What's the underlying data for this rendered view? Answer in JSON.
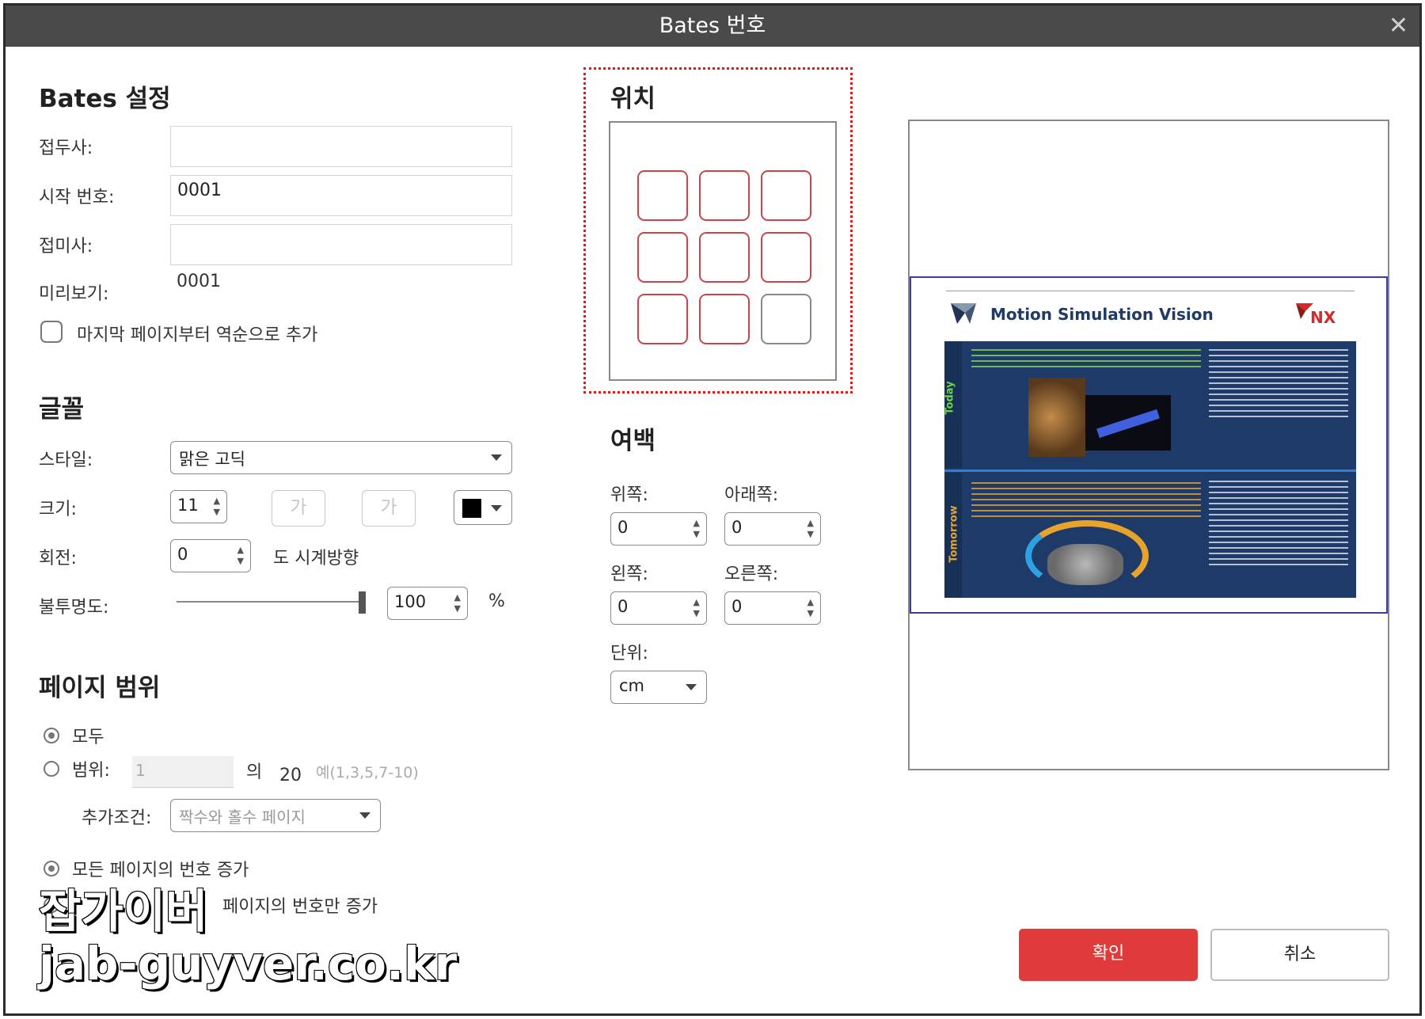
{
  "window": {
    "title": "Bates 번호",
    "close_glyph": "✕"
  },
  "bates": {
    "title": "Bates 설정",
    "prefix_label": "접두사:",
    "prefix_value": "",
    "start_label": "시작 번호:",
    "start_value": "0001",
    "suffix_label": "접미사:",
    "suffix_value": "",
    "preview_label": "미리보기:",
    "preview_value": "0001",
    "reverse_label": "마지막 페이지부터 역순으로 추가"
  },
  "font": {
    "title": "글꼴",
    "style_label": "스타일:",
    "style_value": "맑은 고딕",
    "size_label": "크기:",
    "size_value": "11",
    "bold_glyph": "가",
    "italic_glyph": "가",
    "color": "#000000",
    "rotation_label": "회전:",
    "rotation_value": "0",
    "rotation_unit": "도 시계방향",
    "opacity_label": "불투명도:",
    "opacity_value": "100",
    "opacity_unit": "%"
  },
  "range": {
    "title": "페이지 범위",
    "all_label": "모두",
    "range_label": "범위:",
    "range_value": "1",
    "of_label": "의",
    "total_pages": "20",
    "example": "예(1,3,5,7-10)",
    "condition_label": "추가조건:",
    "condition_value": "짝수와 홀수 페이지",
    "increment_all_label": "모든 페이지의 번호 증가",
    "increment_only_label": "페이지의 번호만 증가"
  },
  "position": {
    "title": "위치",
    "selected_index": 8
  },
  "margin": {
    "title": "여백",
    "top_label": "위쪽:",
    "top_value": "0",
    "bottom_label": "아래쪽:",
    "bottom_value": "0",
    "left_label": "왼쪽:",
    "left_value": "0",
    "right_label": "오른쪽:",
    "right_value": "0",
    "unit_label": "단위:",
    "unit_value": "cm"
  },
  "preview_slide": {
    "title": "Motion Simulation Vision",
    "logo": "NX",
    "today_label": "Today",
    "tomorrow_label": "Tomorrow"
  },
  "buttons": {
    "ok": "확인",
    "cancel": "취소"
  },
  "watermark": {
    "line1": "잡가이버",
    "line2": "jab-guyver.co.kr"
  },
  "colors": {
    "accent": "#e03a3a",
    "titlebar": "#4a4a4a",
    "position_border": "#c9454b",
    "slide_bg": "#1e3a68"
  }
}
